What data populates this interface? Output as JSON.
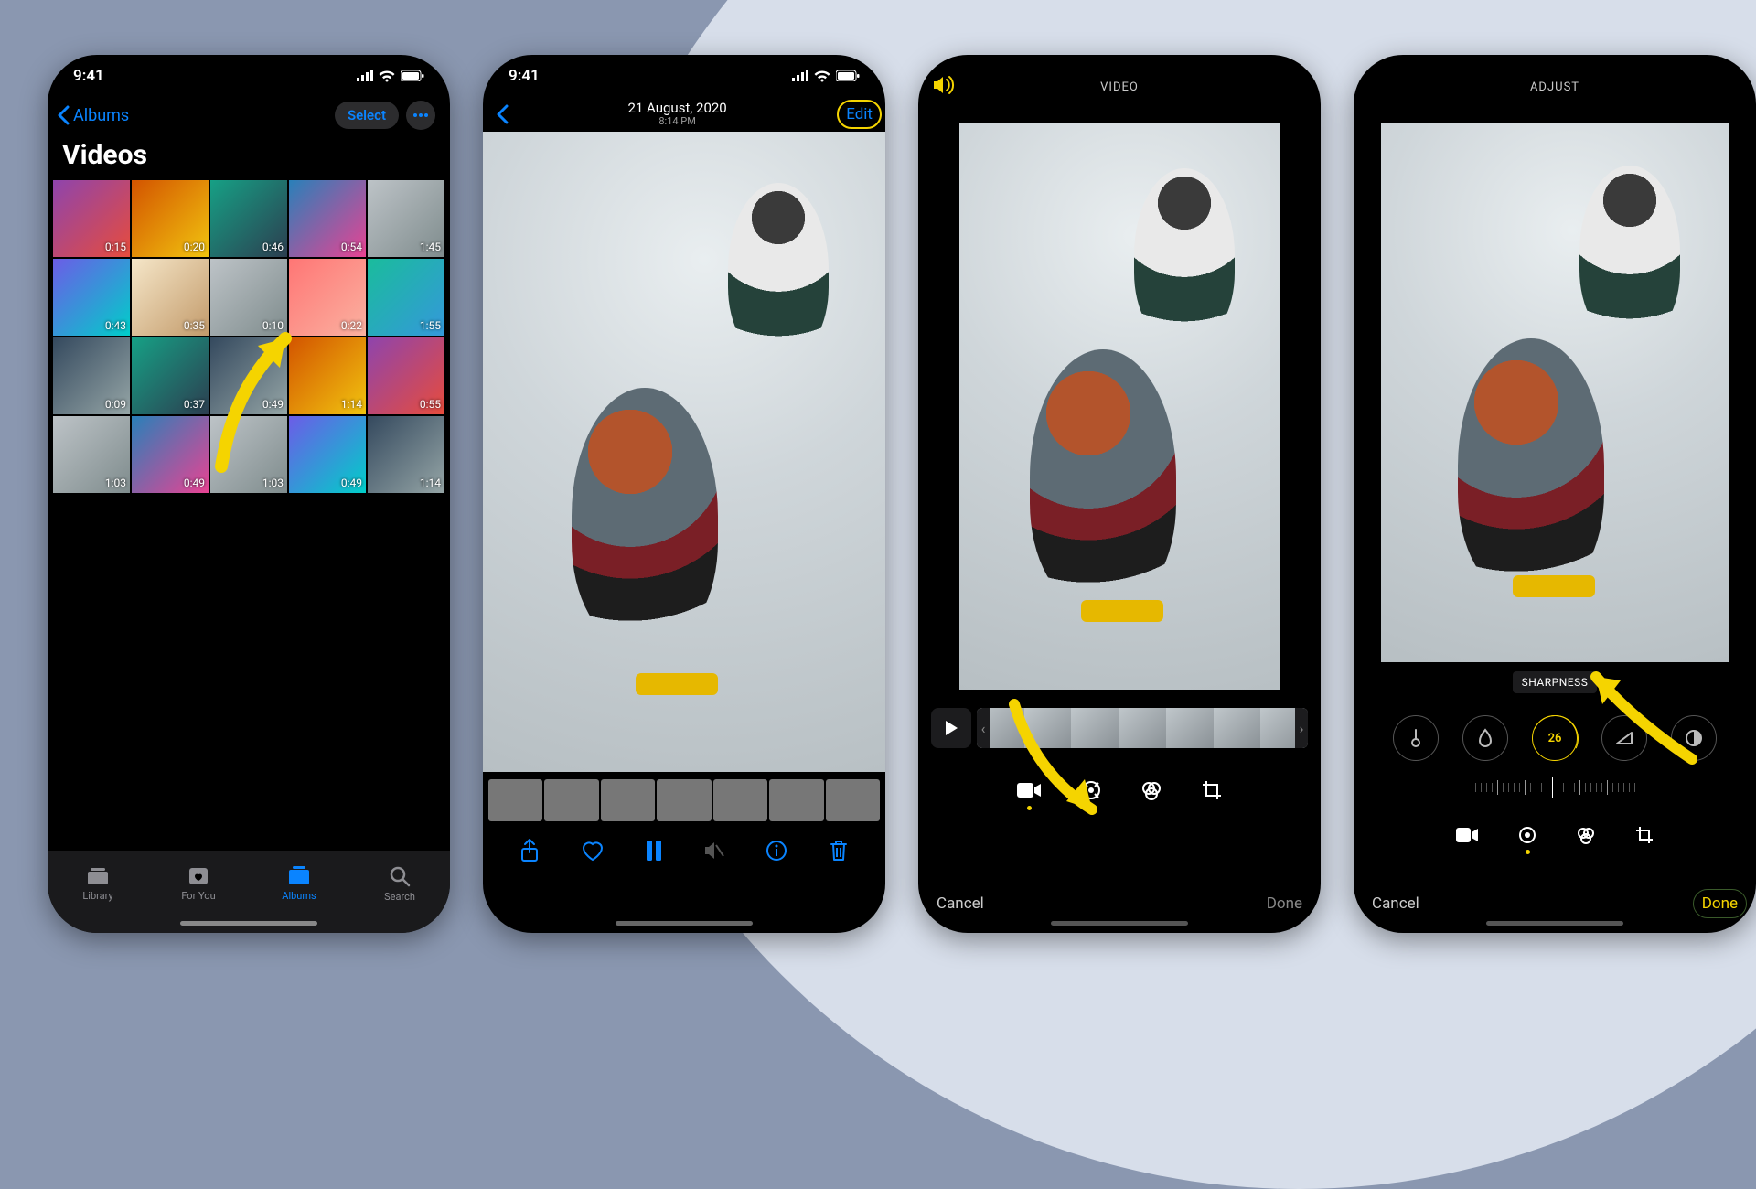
{
  "status": {
    "time": "9:41"
  },
  "screen1": {
    "back_label": "Albums",
    "select_label": "Select",
    "title": "Videos",
    "durations": [
      "0:15",
      "0:20",
      "0:46",
      "0:54",
      "1:45",
      "0:43",
      "0:35",
      "0:10",
      "0:22",
      "1:55",
      "0:09",
      "0:37",
      "0:49",
      "1:14",
      "0:55",
      "1:03",
      "0:49",
      "1:03",
      "0:49",
      "1:14"
    ],
    "tabs": {
      "library": "Library",
      "foryou": "For You",
      "albums": "Albums",
      "search": "Search"
    }
  },
  "screen2": {
    "date": "21 August, 2020",
    "time": "8:14 PM",
    "edit_label": "Edit"
  },
  "screen3": {
    "header": "VIDEO",
    "cancel": "Cancel",
    "done": "Done"
  },
  "screen4": {
    "header": "ADJUST",
    "label": "SHARPNESS",
    "value": "26",
    "cancel": "Cancel",
    "done": "Done"
  }
}
